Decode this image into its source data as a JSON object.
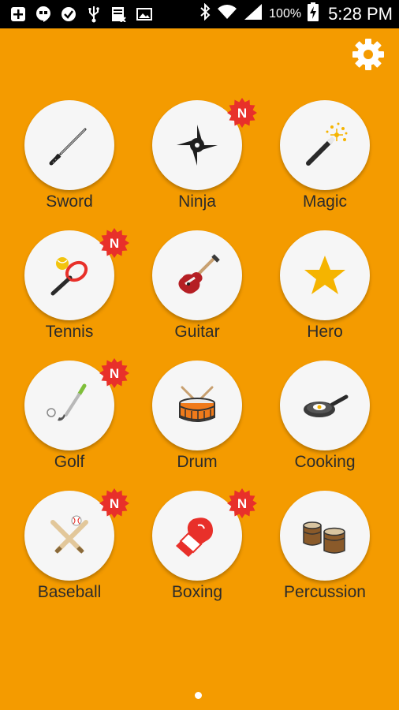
{
  "status_bar": {
    "battery_percent": "100%",
    "time": "5:28 PM",
    "left_icons": [
      "plus-box-icon",
      "hangouts-icon",
      "checkmark-circle-icon",
      "usb-icon",
      "news-icon",
      "gallery-icon"
    ],
    "right_icons": [
      "bluetooth-icon",
      "wifi-icon",
      "signal-icon",
      "battery-charging-icon"
    ]
  },
  "header": {
    "settings_icon": "gear-icon"
  },
  "apps": [
    {
      "label": "Sword",
      "icon": "sword-icon",
      "is_new": false
    },
    {
      "label": "Ninja",
      "icon": "shuriken-icon",
      "is_new": true
    },
    {
      "label": "Magic",
      "icon": "magic-wand-icon",
      "is_new": false
    },
    {
      "label": "Tennis",
      "icon": "tennis-racket-icon",
      "is_new": true
    },
    {
      "label": "Guitar",
      "icon": "guitar-icon",
      "is_new": false
    },
    {
      "label": "Hero",
      "icon": "star-icon",
      "is_new": false
    },
    {
      "label": "Golf",
      "icon": "golf-club-icon",
      "is_new": true
    },
    {
      "label": "Drum",
      "icon": "drum-icon",
      "is_new": false
    },
    {
      "label": "Cooking",
      "icon": "frying-pan-icon",
      "is_new": false
    },
    {
      "label": "Baseball",
      "icon": "baseball-bats-icon",
      "is_new": true
    },
    {
      "label": "Boxing",
      "icon": "boxing-glove-icon",
      "is_new": true
    },
    {
      "label": "Percussion",
      "icon": "percussion-drums-icon",
      "is_new": false
    }
  ],
  "badge": {
    "text": "N",
    "color": "#e8302a"
  },
  "colors": {
    "background": "#f49b00",
    "label": "#2b2b2b"
  },
  "pager": {
    "current_page": 1,
    "total_pages": 1
  }
}
